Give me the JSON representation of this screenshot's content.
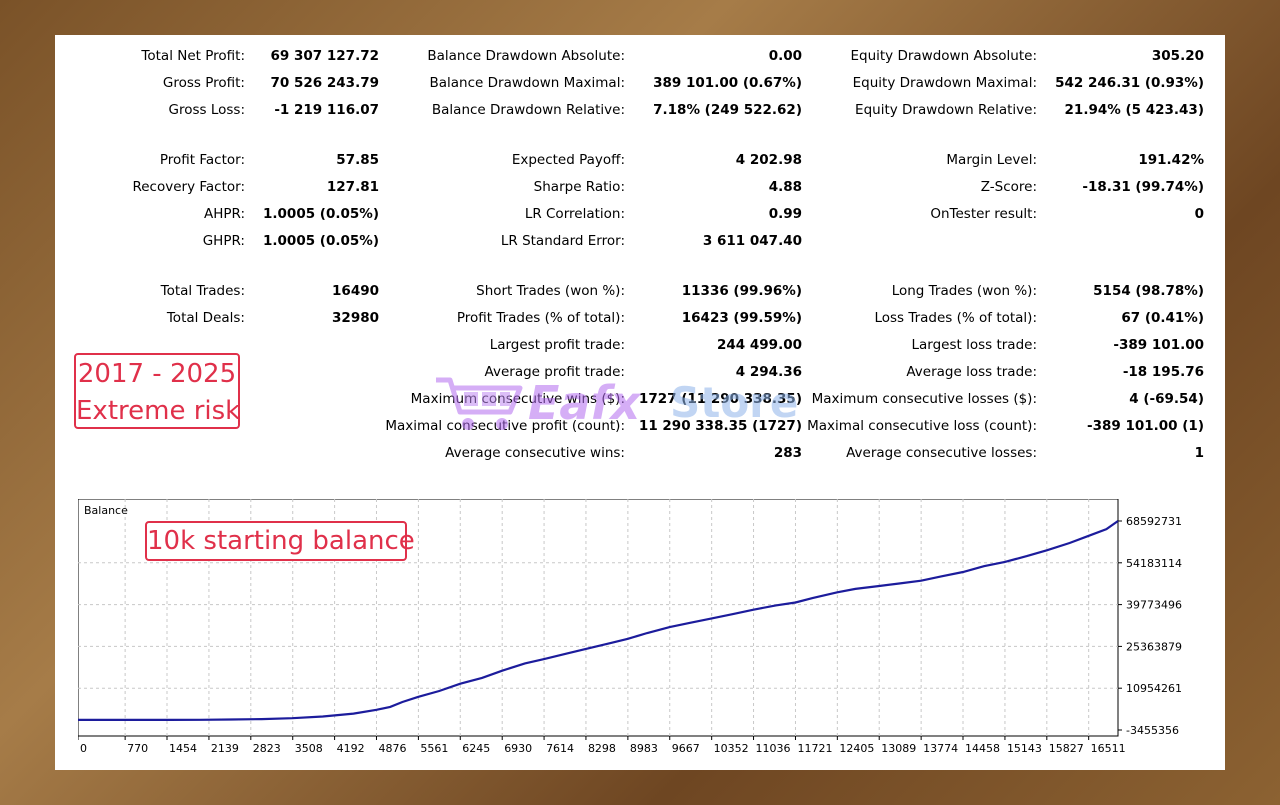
{
  "stats": {
    "col1": [
      {
        "label": "Total Net Profit:",
        "value": "69 307 127.72"
      },
      {
        "label": "Gross Profit:",
        "value": "70 526 243.79"
      },
      {
        "label": "Gross Loss:",
        "value": "-1 219 116.07"
      },
      {
        "label": "Profit Factor:",
        "value": "57.85"
      },
      {
        "label": "Recovery Factor:",
        "value": "127.81"
      },
      {
        "label": "AHPR:",
        "value": "1.0005 (0.05%)"
      },
      {
        "label": "GHPR:",
        "value": "1.0005 (0.05%)"
      },
      {
        "label": "Total Trades:",
        "value": "16490"
      },
      {
        "label": "Total Deals:",
        "value": "32980"
      }
    ],
    "col2": [
      {
        "label": "Balance Drawdown Absolute:",
        "value": "0.00"
      },
      {
        "label": "Balance Drawdown Maximal:",
        "value": "389 101.00 (0.67%)"
      },
      {
        "label": "Balance Drawdown Relative:",
        "value": "7.18% (249 522.62)"
      },
      {
        "label": "Expected Payoff:",
        "value": "4 202.98"
      },
      {
        "label": "Sharpe Ratio:",
        "value": "4.88"
      },
      {
        "label": "LR Correlation:",
        "value": "0.99"
      },
      {
        "label": "LR Standard Error:",
        "value": "3 611 047.40"
      },
      {
        "label": "Short Trades (won %):",
        "value": "11336 (99.96%)"
      },
      {
        "label": "Profit Trades (% of total):",
        "value": "16423 (99.59%)"
      },
      {
        "label": "Largest profit trade:",
        "value": "244 499.00"
      },
      {
        "label": "Average profit trade:",
        "value": "4 294.36"
      },
      {
        "label": "Maximum consecutive wins ($):",
        "value": "1727 (11 290 338.35)"
      },
      {
        "label": "Maximal consecutive profit (count):",
        "value": "11 290 338.35 (1727)"
      },
      {
        "label": "Average consecutive wins:",
        "value": "283"
      }
    ],
    "col3": [
      {
        "label": "Equity Drawdown Absolute:",
        "value": "305.20"
      },
      {
        "label": "Equity Drawdown Maximal:",
        "value": "542 246.31 (0.93%)"
      },
      {
        "label": "Equity Drawdown Relative:",
        "value": "21.94% (5 423.43)"
      },
      {
        "label": "Margin Level:",
        "value": "191.42%"
      },
      {
        "label": "Z-Score:",
        "value": "-18.31 (99.74%)"
      },
      {
        "label": "OnTester result:",
        "value": "0"
      },
      {
        "label": "Long Trades (won %):",
        "value": "5154 (98.78%)"
      },
      {
        "label": "Loss Trades (% of total):",
        "value": "67 (0.41%)"
      },
      {
        "label": "Largest loss trade:",
        "value": "-389 101.00"
      },
      {
        "label": "Average loss trade:",
        "value": "-18 195.76"
      },
      {
        "label": "Maximum consecutive losses ($):",
        "value": "4 (-69.54)"
      },
      {
        "label": "Maximal consecutive loss (count):",
        "value": "-389 101.00 (1)"
      },
      {
        "label": "Average consecutive losses:",
        "value": "1"
      }
    ]
  },
  "annotations": {
    "period_line1": "2017 - 2025",
    "period_line2": "Extreme risk",
    "balance_note": "10k starting balance"
  },
  "watermark": {
    "text_primary": "Eafx",
    "text_secondary": "Store"
  },
  "colors": {
    "line": "#1c1c9c",
    "annotation": "#e0304a",
    "grid": "#c8c8c8"
  },
  "chart_data": {
    "type": "line",
    "title": "Balance",
    "xlabel": "",
    "ylabel": "",
    "x_ticks": [
      0,
      770,
      1454,
      2139,
      2823,
      3508,
      4192,
      4876,
      5561,
      6245,
      6930,
      7614,
      8298,
      8983,
      9667,
      10352,
      11036,
      11721,
      12405,
      13089,
      13774,
      14458,
      15143,
      15827,
      16511
    ],
    "y_ticks": [
      -3455356,
      10954261,
      25363879,
      39773496,
      54183114,
      68592731
    ],
    "xlim": [
      0,
      16990
    ],
    "ylim": [
      -3455356,
      68592731
    ],
    "grid": true,
    "series": [
      {
        "values_x": [
          0,
          500,
          1000,
          1500,
          2000,
          2500,
          3000,
          3500,
          4000,
          4500,
          4876,
          5100,
          5300,
          5561,
          5900,
          6245,
          6600,
          6930,
          7300,
          7614,
          8000,
          8298,
          8700,
          8983,
          9300,
          9667,
          10000,
          10352,
          10700,
          11036,
          11400,
          11721,
          12000,
          12405,
          12700,
          13089,
          13400,
          13774,
          14100,
          14458,
          14800,
          15143,
          15500,
          15827,
          16200,
          16511,
          16800,
          16990
        ],
        "values_y": [
          10000,
          10000,
          10000,
          12000,
          50000,
          150000,
          300000,
          600000,
          1200000,
          2200000,
          3500000,
          4500000,
          6200000,
          8000000,
          10000000,
          12500000,
          14500000,
          17000000,
          19500000,
          21000000,
          23000000,
          24500000,
          26500000,
          28000000,
          30000000,
          32000000,
          33500000,
          35000000,
          36500000,
          38000000,
          39500000,
          40500000,
          42000000,
          44000000,
          45200000,
          46200000,
          47000000,
          48000000,
          49500000,
          51000000,
          53000000,
          54500000,
          56500000,
          58500000,
          61000000,
          63500000,
          65800000,
          68592731
        ]
      }
    ]
  }
}
